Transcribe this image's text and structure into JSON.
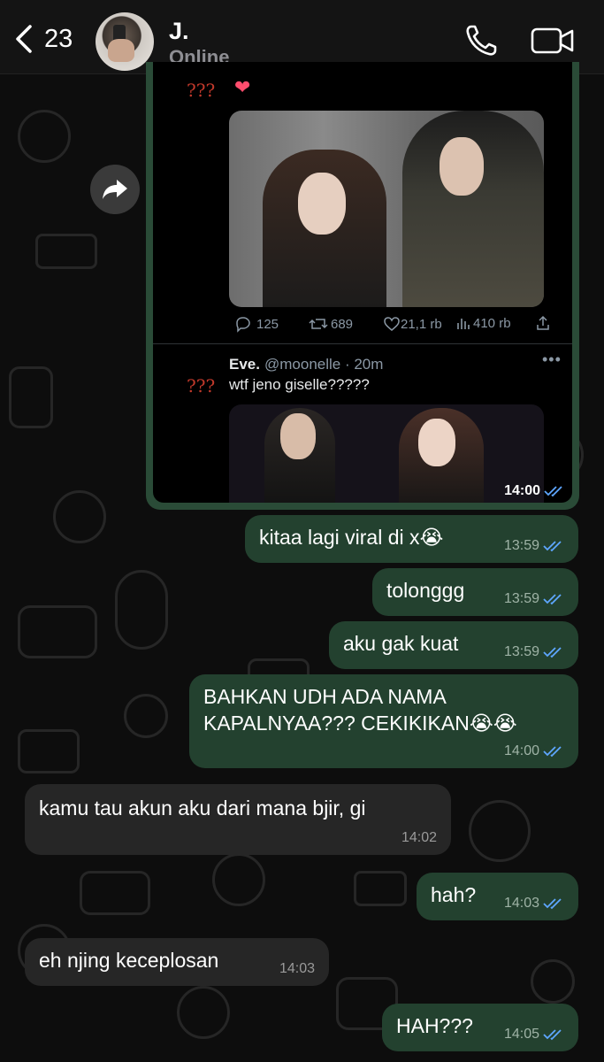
{
  "header": {
    "back_count": "23",
    "contact_name": "J.",
    "contact_status": "Online"
  },
  "media": {
    "question_marks_1": "???",
    "question_marks_2": "???",
    "tweet1_stats": {
      "replies": "125",
      "retweets": "689",
      "likes": "21,1 rb",
      "views": "410 rb"
    },
    "tweet2": {
      "name": "Eve.",
      "handle_time": "@moonelle · 20m",
      "text": "wtf jeno giselle?????"
    },
    "time": "14:00"
  },
  "messages": [
    {
      "dir": "out",
      "text": "kitaa lagi viral di x😭",
      "time": "13:59"
    },
    {
      "dir": "out",
      "text": "tolonggg",
      "time": "13:59"
    },
    {
      "dir": "out",
      "text": "aku gak kuat",
      "time": "13:59"
    },
    {
      "dir": "out",
      "line1": "BAHKAN UDH ADA NAMA",
      "line2": "KAPALNYAA??? CEKIKIKAN😭😭",
      "time": "14:00"
    },
    {
      "dir": "in",
      "text": "kamu tau akun aku dari mana bjir, gi",
      "time": "14:02"
    },
    {
      "dir": "out",
      "text": "hah?",
      "time": "14:03"
    },
    {
      "dir": "in",
      "text": "eh njing keceplosan",
      "time": "14:03"
    },
    {
      "dir": "out",
      "text": "HAH???",
      "time": "14:05"
    }
  ],
  "icons": {
    "back": "chevron-left-icon",
    "call": "phone-icon",
    "video": "video-camera-icon",
    "forward": "forward-arrow-icon",
    "read": "double-check-icon"
  },
  "colors": {
    "outgoing_bubble": "#23412f",
    "incoming_bubble": "#262626",
    "read_tick": "#5ea7ff"
  }
}
